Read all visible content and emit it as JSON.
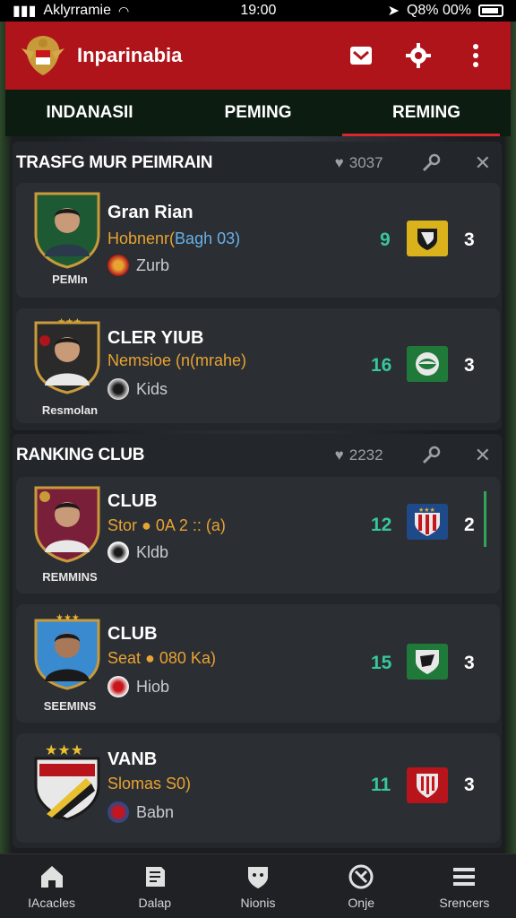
{
  "status_bar": {
    "carrier": "Aklyrramie",
    "time": "19:00",
    "battery_text": "Q8% 00%"
  },
  "app_bar": {
    "title": "Inparinabia"
  },
  "tabs": [
    {
      "label": "INDANASII"
    },
    {
      "label": "PEMING"
    },
    {
      "label": "REMING",
      "active": true
    }
  ],
  "sections": [
    {
      "title": "TRASFG MUR PEIMRAIN",
      "count": "3037"
    },
    {
      "title": "RANKING CLUB",
      "count": "2232"
    }
  ],
  "cards": [
    {
      "name": "Gran Rian",
      "sub_prefix": "Hobnenr(",
      "sub_highlight": "Bagh 03)",
      "club": "Zurb",
      "avatar_caption": "PEMIn",
      "stat": "9",
      "rank": "3",
      "shield_color": "#1d5a33",
      "badge_color": "#d9b21c"
    },
    {
      "name": "CLER YIUB",
      "sub_prefix": "Nemsioe (n(mrahe)",
      "sub_highlight": "",
      "club": "Kids",
      "avatar_caption": "Resmolan",
      "stat": "16",
      "rank": "3",
      "shield_color": "#2a2a2a",
      "badge_color": "#1f7a3a"
    },
    {
      "name": "CLUB",
      "sub_prefix": "Stor ● 0A 2 :: (a)",
      "sub_highlight": "",
      "club": "Kldb",
      "avatar_caption": "REMMINS",
      "stat": "12",
      "rank": "2",
      "shield_color": "#7a1f3a",
      "badge_color": "#1f4a8a"
    },
    {
      "name": "CLUB",
      "sub_prefix": "Seat ● 080 Ka)",
      "sub_highlight": "",
      "club": "Hiob",
      "avatar_caption": "SEEMINS",
      "stat": "15",
      "rank": "3",
      "shield_color": "#3a8ad0",
      "badge_color": "#1f7a3a"
    },
    {
      "name": "VANB",
      "sub_prefix": "Slomas S0)",
      "sub_highlight": "",
      "club": "Babn",
      "avatar_caption": "",
      "stat": "11",
      "rank": "3",
      "shield_color": "#b8141b",
      "badge_color": "#b8141b"
    }
  ],
  "bottom_nav": [
    {
      "label": "IAcacles",
      "icon": "home-icon"
    },
    {
      "label": "Dalap",
      "icon": "book-icon"
    },
    {
      "label": "Nionis",
      "icon": "shield-icon"
    },
    {
      "label": "Onje",
      "icon": "ball-icon"
    },
    {
      "label": "Srencers",
      "icon": "menu-icon"
    }
  ],
  "colors": {
    "primary_red": "#b0141b",
    "accent_green": "#37c89a",
    "tab_bg": "#0c1c11",
    "card_bg": "#2b2e33"
  }
}
